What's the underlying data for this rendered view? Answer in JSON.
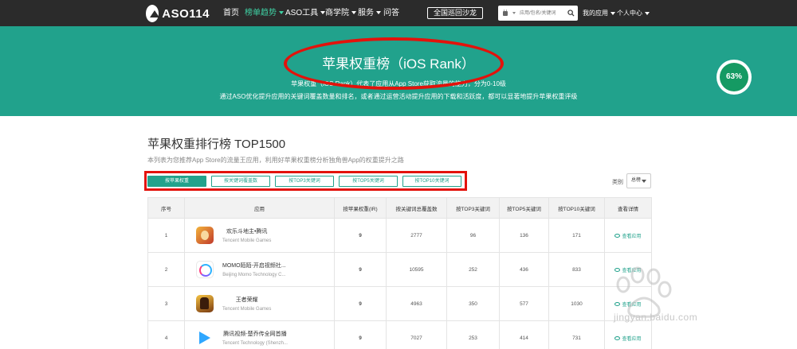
{
  "nav": {
    "logo_text": "ASO114",
    "items": [
      {
        "label": "首页",
        "active": false,
        "caret": false
      },
      {
        "label": "榜单趋势",
        "active": true,
        "caret": true
      },
      {
        "label": "ASO工具",
        "active": false,
        "caret": true
      },
      {
        "label": "商学院",
        "active": false,
        "caret": true
      },
      {
        "label": "服务",
        "active": false,
        "caret": true
      },
      {
        "label": "问答",
        "active": false,
        "caret": false
      }
    ],
    "salon_label": "全国巡回沙龙",
    "search_placeholder": "应用/包名/关键词",
    "my_apps": "我的应用",
    "user_center": "个人中心"
  },
  "hero": {
    "title": "苹果权重榜（iOS Rank）",
    "desc_line1": "苹果权重（iOS Rank）代表了应用从App Store获取流量的能力，分为0-10级",
    "desc_line2": "通过ASO优化提升应用的关键词覆盖数量和排名，或者通过运营活动提升应用的下载和活跃度，都可以显著地提升苹果权重评级",
    "gauge_value": "63%",
    "accent": "#21a28c",
    "highlight_color": "#e3120b"
  },
  "section": {
    "title": "苹果权重排行榜 TOP1500",
    "subtitle": "本列表为您推荐App Store的流量王应用，利用好苹果权重榜分析独角兽App的权重提升之路"
  },
  "tabs": [
    {
      "label": "按苹果权重",
      "active": true
    },
    {
      "label": "按关键词覆盖数",
      "active": false
    },
    {
      "label": "按TOP3关键词",
      "active": false
    },
    {
      "label": "按TOP5关键词",
      "active": false
    },
    {
      "label": "按TOP10关键词",
      "active": false
    }
  ],
  "category": {
    "label": "类别",
    "value": "总榜"
  },
  "table": {
    "headers": [
      "序号",
      "应用",
      "按苹果权重(IR)",
      "按关键词总覆盖数",
      "按TOP3关键词",
      "按TOP5关键词",
      "按TOP10关键词",
      "查看详情"
    ],
    "detail_label": "查看应用",
    "rows": [
      {
        "rank": "1",
        "name": "欢乐斗地主•腾讯",
        "developer": "Tencent Mobile Games",
        "icon": "doudizhu-icon",
        "weight": "9",
        "total": "2777",
        "top3": "96",
        "top5": "136",
        "top10": "171"
      },
      {
        "rank": "2",
        "name": "MOMO陌陌-开启视频社...",
        "developer": "Beijing Momo Technology C...",
        "icon": "momo-icon",
        "weight": "9",
        "total": "10595",
        "top3": "252",
        "top5": "436",
        "top10": "833"
      },
      {
        "rank": "3",
        "name": "王者荣耀",
        "developer": "Tencent Mobile Games",
        "icon": "wangzherongyao-icon",
        "weight": "9",
        "total": "4963",
        "top3": "350",
        "top5": "577",
        "top10": "1030"
      },
      {
        "rank": "4",
        "name": "腾讯视频-楚乔传全网首播",
        "developer": "Tencent Technology (Shenzh...",
        "icon": "tencent-video-icon",
        "weight": "9",
        "total": "7027",
        "top3": "253",
        "top5": "414",
        "top10": "731"
      }
    ]
  },
  "watermark": {
    "brand": "Baidu经验",
    "url": "jingyan.baidu.com"
  }
}
